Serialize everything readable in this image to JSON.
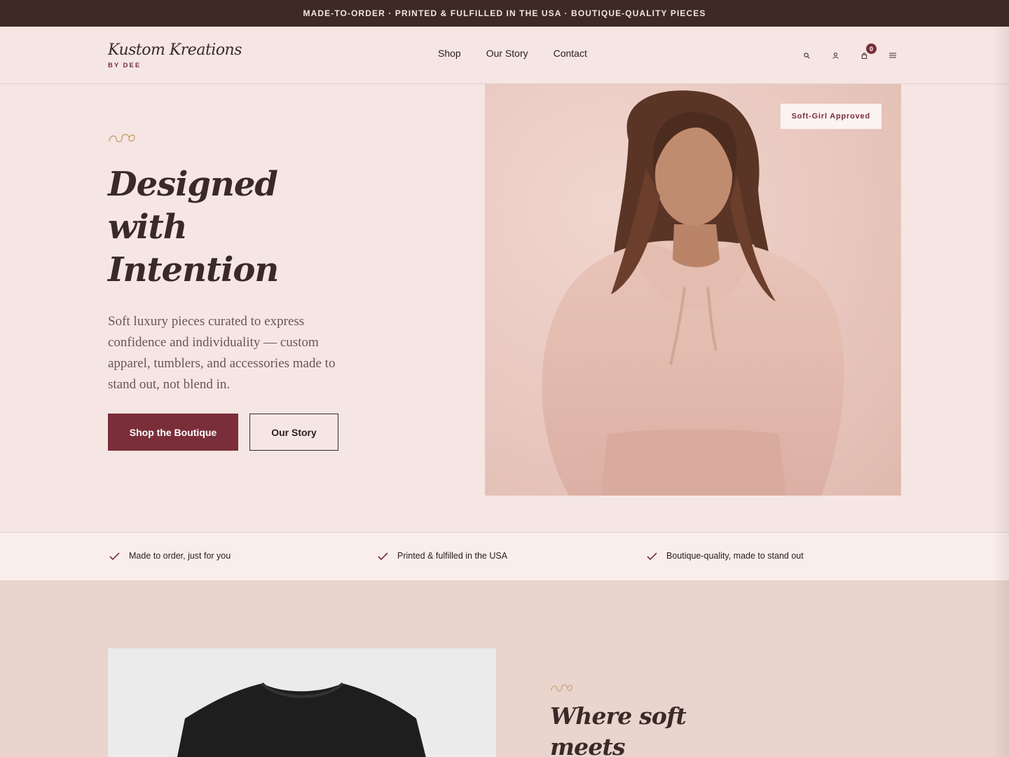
{
  "announcement": "MADE-TO-ORDER · PRINTED & FULFILLED IN THE USA · BOUTIQUE-QUALITY PIECES",
  "header": {
    "logo_main": "Kustom Kreations",
    "logo_sub": "BY DEE",
    "nav": [
      "Shop",
      "Our Story",
      "Contact"
    ],
    "icons": [
      "search-icon",
      "account-icon",
      "cart-icon",
      "menu-icon"
    ],
    "cart_count": "0"
  },
  "hero": {
    "title": "Designed with Intention",
    "description": "Soft luxury pieces curated to express confidence and individuality — custom apparel, tumblers, and accessories made to stand out, not blend in.",
    "primary_button": "Shop the Boutique",
    "secondary_button": "Our Story",
    "image_tag": "Soft-Girl Approved"
  },
  "features": [
    "Made to order, just for you",
    "Printed & fulfilled in the USA",
    "Boutique-quality, made to stand out"
  ],
  "section2": {
    "title": "Where soft meets statement"
  },
  "colors": {
    "accent": "#7a2e3a",
    "background": "#f5e6e4",
    "dark": "#3d2a25",
    "gold": "#c9a06a"
  }
}
